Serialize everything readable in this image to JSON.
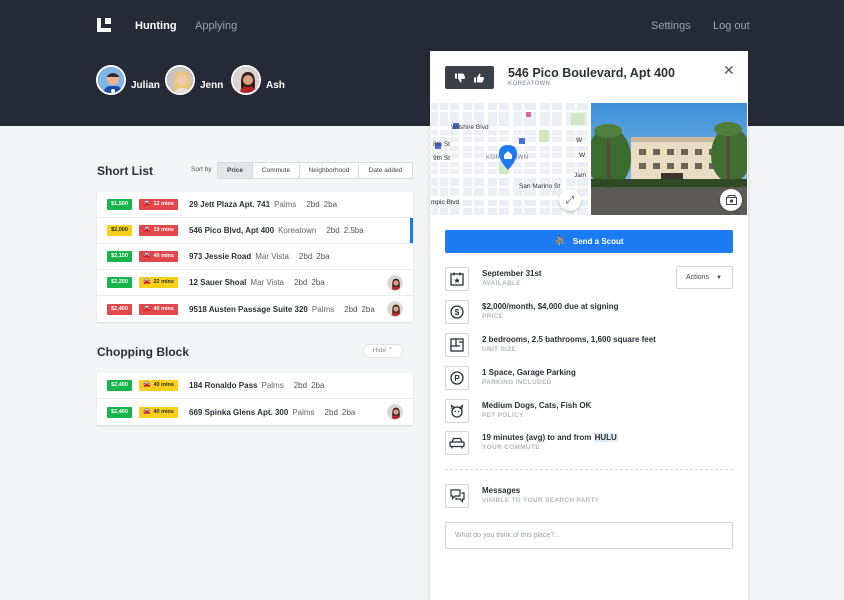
{
  "nav": {
    "hunting": "Hunting",
    "applying": "Applying",
    "settings": "Settings",
    "logout": "Log out"
  },
  "party": [
    {
      "name": "Julian"
    },
    {
      "name": "Jenn"
    },
    {
      "name": "Ash"
    }
  ],
  "shortlist": {
    "title": "Short List",
    "sort_label": "Sort by",
    "sort_options": [
      "Price",
      "Commute",
      "Neighborhood",
      "Date added"
    ],
    "rows": [
      {
        "price": "$1,500",
        "commute": "12 mins",
        "address": "29 Jett Plaza Apt. 741",
        "hood": "Palms",
        "beds": "2bd",
        "baths": "2ba"
      },
      {
        "price": "$2,000",
        "commute": "19 mins",
        "address": "546 Pico Blvd, Apt 400",
        "hood": "Koreatown",
        "beds": "2bd",
        "baths": "2.5ba"
      },
      {
        "price": "$2,150",
        "commute": "40 mins",
        "address": "973 Jessie Road",
        "hood": "Mar Vista",
        "beds": "2bd",
        "baths": "2ba"
      },
      {
        "price": "$2,200",
        "commute": "22 mins",
        "address": "12 Sauer Shoal",
        "hood": "Mar Vista",
        "beds": "2bd",
        "baths": "2ba"
      },
      {
        "price": "$2,400",
        "commute": "40 mins",
        "address": "9518 Austen Passage Suite 320",
        "hood": "Palms",
        "beds": "2bd",
        "baths": "2ba"
      }
    ]
  },
  "chopping": {
    "title": "Chopping Block",
    "hide_label": "Hide",
    "rows": [
      {
        "price": "$2,400",
        "commute": "40 mins",
        "address": "184 Ronaldo Pass",
        "hood": "Palms",
        "beds": "2bd",
        "baths": "2ba"
      },
      {
        "price": "$2,400",
        "commute": "40 mins",
        "address": "669 Spinka Glens Apt. 300",
        "hood": "Palms",
        "beds": "2bd",
        "baths": "2ba"
      }
    ]
  },
  "detail": {
    "title": "546 Pico Boulevard, Apt 400",
    "neighborhood": "KOREATOWN",
    "map_labels": {
      "wilshire": "Wilshire Blvd",
      "eighth": "8th St",
      "ninth": "9th St",
      "san_marino": "San Marino St",
      "olympic": "mpic Blvd",
      "koreatown": "KOREATOWN",
      "w1": "W",
      "w2": "W",
      "jam": "Jam"
    },
    "scout_label": "Send a Scout",
    "actions_label": "Actions",
    "available": {
      "main": "September 31st",
      "sub": "AVAILABLE"
    },
    "price": {
      "main": "$2,000/month, $4,000 due at signing",
      "sub": "PRICE"
    },
    "size": {
      "main": "2 bedrooms, 2.5 bathrooms, 1,600 square feet",
      "sub": "UNIT SIZE"
    },
    "parking": {
      "main": "1 Space, Garage Parking",
      "sub": "PARKING INCLUDED"
    },
    "pets": {
      "main": "Medium Dogs, Cats, Fish OK",
      "sub": "PET POLICY"
    },
    "commute": {
      "main": "19 minutes (avg) to and from",
      "dest": "HULU",
      "sub": "YOUR COMMUTE"
    },
    "messages": {
      "main": "Messages",
      "sub": "VISIBLE TO YOUR SEARCH PARTY"
    },
    "comment_placeholder": "What do you think of this place?..."
  },
  "colors": {
    "green": "#16b44a",
    "red": "#e2474b",
    "yellow": "#f7cf1c",
    "blue": "#1c7bf2",
    "dark": "#262a36"
  }
}
